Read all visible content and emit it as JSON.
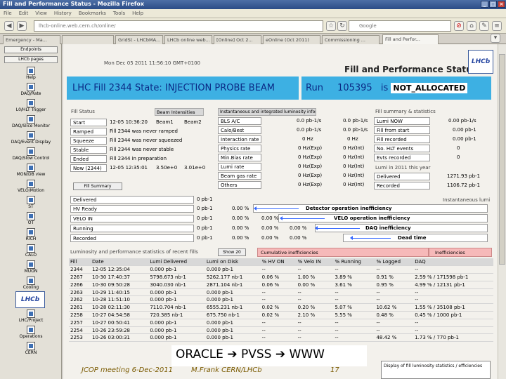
{
  "window": {
    "title": "Fill and Performance Status - Mozilla Firefox"
  },
  "menu": [
    "File",
    "Edit",
    "View",
    "History",
    "Bookmarks",
    "Tools",
    "Help"
  ],
  "nav": {
    "url": "lhcb-online.web.cern.ch/online/",
    "search_placeholder": "Google"
  },
  "tabs": [
    "Emergency - Ma...",
    "",
    "GridSt - LHCbMA...",
    "LHCb online web...",
    "[Online] Oct 2...",
    "eOnline (Oct 2011)",
    "Commissioning ...",
    "Fill and Perfor..."
  ],
  "sidebar": {
    "top": [
      "Endpoints",
      "LHCb pages"
    ],
    "items": [
      "Help",
      "DAQ/Rate",
      "L0/HLT Trigger",
      "DAQ/Slice Monitor",
      "DAQ/Event Display",
      "DAQ/Slow Control",
      "MON/DB view",
      "VELO/Motion",
      "ST",
      "OT",
      "RICH",
      "CALO",
      "MUON",
      "Cooling",
      "",
      "LHC/Project",
      "Operations",
      "CERN"
    ],
    "logo": "LHCb"
  },
  "page": {
    "timestamp": "Mon Dec 05 2011 11:56:10 GMT+0100",
    "title": "Fill and Performance Status",
    "logo": "LHCb",
    "banner_fill": "LHC Fill 2344 State: INJECTION PROBE BEAM",
    "banner_run_label": "Run",
    "banner_run": "105395",
    "banner_is": "is",
    "banner_state": "NOT_ALLOCATED",
    "fill_status": {
      "header": "Fill Status",
      "intensities_header": "Beam Intensities",
      "beam_headers": [
        "Beam1",
        "Beam2"
      ],
      "rows": [
        {
          "label": "Start",
          "time": "12-05 10:36:20",
          "b1": "Beam1",
          "b2": "Beam2"
        },
        {
          "label": "Ramped",
          "time": "Fill 2344 was never ramped",
          "b1": "",
          "b2": ""
        },
        {
          "label": "Squeeze",
          "time": "Fill 2344 was never squeezed",
          "b1": "",
          "b2": ""
        },
        {
          "label": "Stable",
          "time": "Fill 2344 was never stable",
          "b1": "",
          "b2": ""
        },
        {
          "label": "Ended",
          "time": "Fill 2344 in preparation",
          "b1": "",
          "b2": ""
        },
        {
          "label": "Now (2344)",
          "time": "12-05 12:35:01",
          "b1": "3.50e+0",
          "b2": "3.01e+0"
        }
      ],
      "button": "Fill Summary"
    },
    "integrated": {
      "header": "Instantaneous and integrated luminosity information",
      "rows": [
        {
          "label": "BLS A/C",
          "v1": "0.0 pb-1/s",
          "v2": "0.0 pb-1/s"
        },
        {
          "label": "Calo/Best",
          "v1": "0.0 pb-1/s",
          "v2": "0.0 pb-1/s"
        },
        {
          "label": "Interaction rate",
          "v1": "0 Hz",
          "v2": "0 Hz"
        },
        {
          "label": "Physics rate",
          "v1": "0 Hz(Exp)",
          "v2": "0 Hz(Int)"
        },
        {
          "label": "Min.Bias rate",
          "v1": "0 Hz(Exp)",
          "v2": "0 Hz(Int)"
        },
        {
          "label": "Lumi rate",
          "v1": "0 Hz(Exp)",
          "v2": "0 Hz(Int)"
        },
        {
          "label": "Beam gas rate",
          "v1": "0 Hz(Exp)",
          "v2": "0 Hz(Int)"
        },
        {
          "label": "Others",
          "v1": "0 Hz(Exp)",
          "v2": "0 Hz(Int)"
        }
      ]
    },
    "fill_summary": {
      "header": "Fill summary & statistics",
      "rows": [
        {
          "label": "Lumi NOW",
          "value": "0.00 pb-1/s"
        },
        {
          "label": "Fill from start",
          "value": "0.00 pb-1"
        },
        {
          "label": "Fill recorded",
          "value": "0.00 pb-1"
        },
        {
          "label": "No. HLT events",
          "value": "0"
        },
        {
          "label": "Evts recorded",
          "value": "0"
        }
      ],
      "year_header": "Lumi in 2011 this year",
      "year_rows": [
        {
          "label": "Delivered",
          "value": "1271.93 pb-1"
        },
        {
          "label": "Recorded",
          "value": "1106.72 pb-1"
        }
      ]
    },
    "luminosity": {
      "header": "Instantaneous lumi",
      "rows": [
        {
          "label": "Delivered",
          "value": "0 pb-1",
          "pct1": "",
          "pct2": "",
          "pct3": ""
        },
        {
          "label": "HV Ready",
          "value": "0 pb-1",
          "pct1": "0.00 %",
          "pct2": "",
          "pct3": ""
        },
        {
          "label": "VELO IN",
          "value": "0 pb-1",
          "pct1": "0.00 %",
          "pct2": "0.00 %",
          "pct3": ""
        },
        {
          "label": "Running",
          "value": "0 pb-1",
          "pct1": "0.00 %",
          "pct2": "0.00 %",
          "pct3": "0.00 %"
        },
        {
          "label": "Recorded",
          "value": "0 pb-1",
          "pct1": "0.00 %",
          "pct2": "0.00 %",
          "pct3": "0.00 %"
        }
      ],
      "arrows": [
        "Detector operation inefficiency",
        "VELO operation inefficiency",
        "DAQ inefficiency",
        "Dead time"
      ]
    },
    "fills": {
      "caption": "Luminosity and performance statistics of recent fills",
      "show_btn": "Show 20",
      "cumulative_label": "Cumulative inefficiencies",
      "ineff_label": "Inefficiencies",
      "headers": [
        "Fill",
        "Date",
        "Lumi Delivered",
        "Lumi on Disk",
        "% HV ON",
        "% Velo IN",
        "% Running",
        "% Logged",
        "DAQ"
      ],
      "rows": [
        [
          "2344",
          "12-05 12:35:04",
          "0.000 pb-1",
          "0.000 pb-1",
          "--",
          "--",
          "--",
          "--",
          "--"
        ],
        [
          "2267",
          "10-30 17:40:37",
          "5798.673 nb-1",
          "5262.177 nb-1",
          "0.06 %",
          "1.00 %",
          "3.89 %",
          "0.91 %",
          "2.59 % / 171598 pb-1"
        ],
        [
          "2266",
          "10-30 09:50:28",
          "3040.030 nb-1",
          "2871.104 nb-1",
          "0.06 %",
          "0.00 %",
          "3.61 %",
          "0.95 %",
          "4.99 % / 12131 pb-1"
        ],
        [
          "2263",
          "10-29 11:40:15",
          "0.000 pb-1",
          "0.000 pb-1",
          "--",
          "--",
          "--",
          "--",
          "--"
        ],
        [
          "2262",
          "10-28 11:51:10",
          "0.000 pb-1",
          "0.000 pb-1",
          "--",
          "--",
          "--",
          "--",
          "--"
        ],
        [
          "2261",
          "10-28 02:11:30",
          "7110.704 nb-1",
          "6555.231 nb-1",
          "0.02 %",
          "0.20 %",
          "5.07 %",
          "10.62 %",
          "1.55 % / 35108 pb-1"
        ],
        [
          "2258",
          "10-27 04:54:58",
          "720.385 nb-1",
          "675.750 nb-1",
          "0.02 %",
          "2.10 %",
          "5.55 %",
          "0.48 %",
          "0.45 % / 1000 pb-1"
        ],
        [
          "2257",
          "10-27 00:50:41",
          "0.000 pb-1",
          "0.000 pb-1",
          "--",
          "--",
          "--",
          "--",
          "--"
        ],
        [
          "2254",
          "10-26 23:59:28",
          "0.000 pb-1",
          "0.000 pb-1",
          "--",
          "--",
          "--",
          "--",
          "--"
        ],
        [
          "2253",
          "10-26 03:00:31",
          "0.000 pb-1",
          "0.000 pb-1",
          "--",
          "--",
          "--",
          "48.42 %",
          "1.73 % / 770 pb-1"
        ]
      ]
    },
    "note": "Display of fill luminosity statistics / efficiencies"
  },
  "footer": {
    "left": "JCOP meeting 6-Dec-2011",
    "center": "M.Frank CERN/LHCb",
    "page": "17",
    "oracle_a": "ORACLE",
    "oracle_b": "PVSS",
    "oracle_c": "WWW"
  }
}
